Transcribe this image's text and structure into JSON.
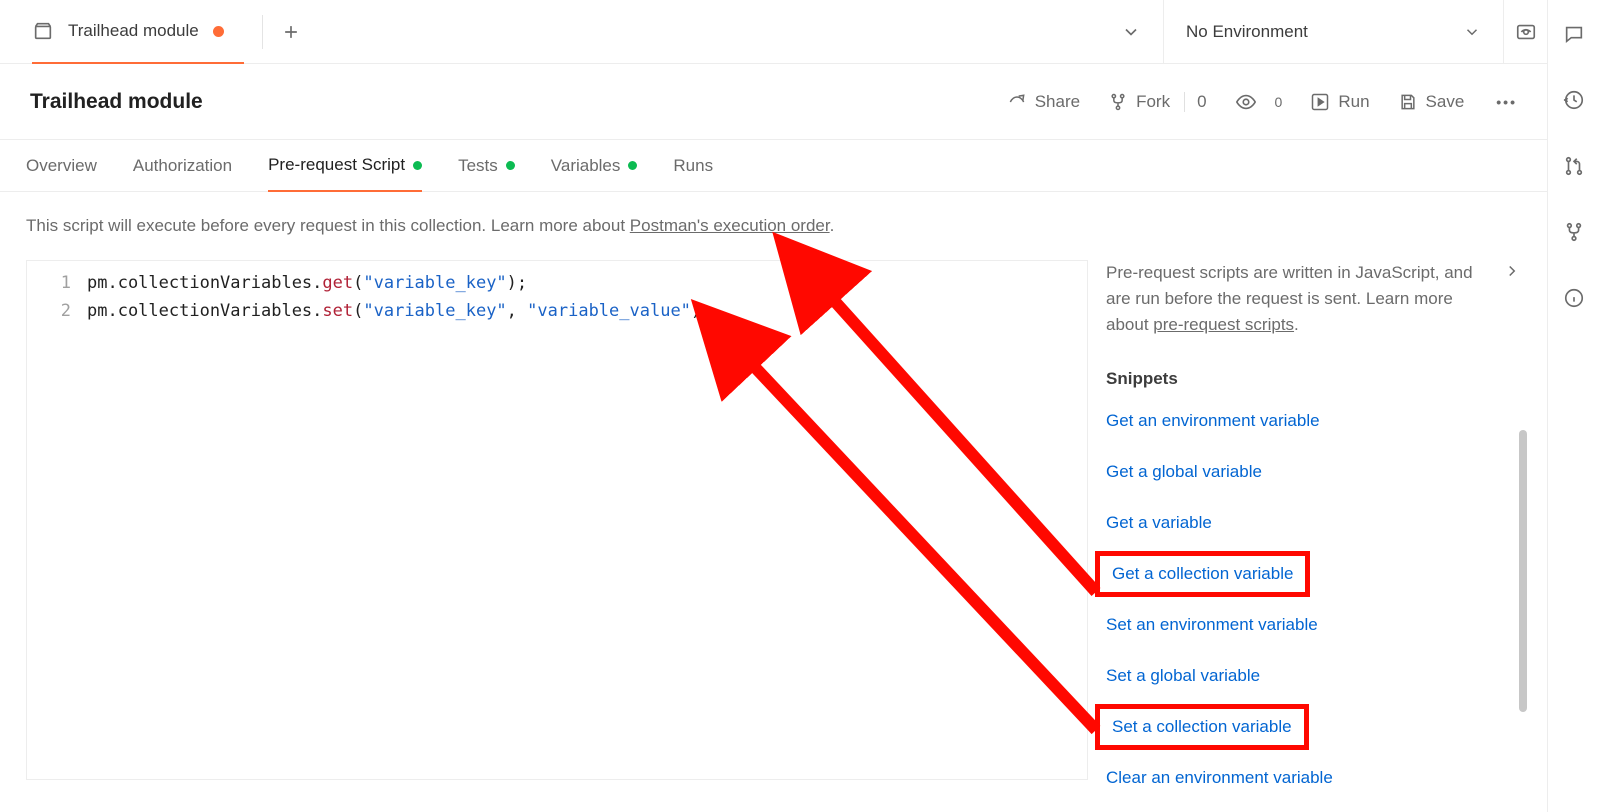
{
  "tab": {
    "label": "Trailhead module",
    "unsaved": true
  },
  "environment": {
    "selected": "No Environment"
  },
  "title": "Trailhead module",
  "actions": {
    "share": "Share",
    "fork": "Fork",
    "fork_count": "0",
    "watch_count": "0",
    "run": "Run",
    "save": "Save"
  },
  "subtabs": {
    "overview": "Overview",
    "authorization": "Authorization",
    "prerequest": "Pre-request Script",
    "tests": "Tests",
    "variables": "Variables",
    "runs": "Runs"
  },
  "description": {
    "text_prefix": "This script will execute before every request in this collection. Learn more about ",
    "link_text": "Postman's execution order",
    "text_suffix": "."
  },
  "code": {
    "lines": [
      {
        "n": "1",
        "obj": "pm.collectionVariables.",
        "method": "get",
        "args": "(\"variable_key\");"
      },
      {
        "n": "2",
        "obj": "pm.collectionVariables.",
        "method": "set",
        "args": "(\"variable_key\", \"variable_value\");"
      }
    ],
    "line1_obj": "pm.collectionVariables.",
    "line1_method": "get",
    "line1_p1": "(",
    "line1_s1": "\"variable_key\"",
    "line1_p2": ");",
    "line2_obj": "pm.collectionVariables.",
    "line2_method": "set",
    "line2_p1": "(",
    "line2_s1": "\"variable_key\"",
    "line2_c": ", ",
    "line2_s2": "\"variable_value\"",
    "line2_p2": ");",
    "ln1": "1",
    "ln2": "2"
  },
  "side": {
    "desc_prefix": "Pre-request scripts are written in JavaScript, and are run before the request is sent. Learn more about ",
    "desc_link": "pre-request scripts",
    "desc_suffix": ".",
    "snippets_title": "Snippets",
    "snippets": {
      "s1": "Get an environment variable",
      "s2": "Get a global variable",
      "s3": "Get a variable",
      "s4": "Get a collection variable",
      "s5": "Set an environment variable",
      "s6": "Set a global variable",
      "s7": "Set a collection variable",
      "s8": "Clear an environment variable"
    }
  }
}
